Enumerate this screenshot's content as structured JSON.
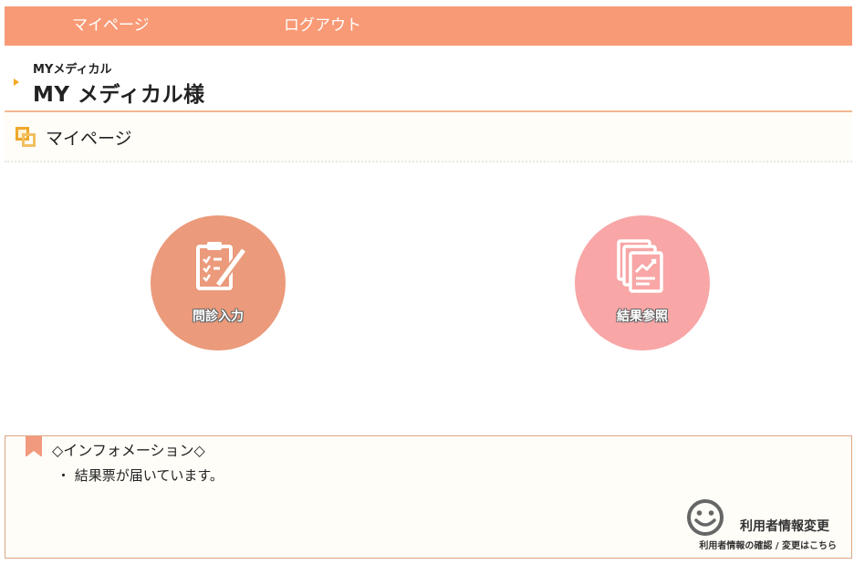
{
  "nav": {
    "mypage": "マイページ",
    "logout": "ログアウト"
  },
  "user": {
    "subtitle": "MYメディカル",
    "name": "MY メディカル様"
  },
  "section": {
    "title": "マイページ"
  },
  "actions": {
    "interview": "問診入力",
    "results": "結果参照"
  },
  "info": {
    "title": "◇インフォメーション◇",
    "items": [
      "・ 結果票が届いています。"
    ]
  },
  "user_change": {
    "title": "利用者情報変更",
    "subtitle": "利用者情報の確認 / 変更はこちら"
  },
  "colors": {
    "nav_bg": "#f99a76",
    "interview_bg": "#eb9a7b",
    "results_bg": "#f8a6a6",
    "accent": "#f0a82c"
  }
}
